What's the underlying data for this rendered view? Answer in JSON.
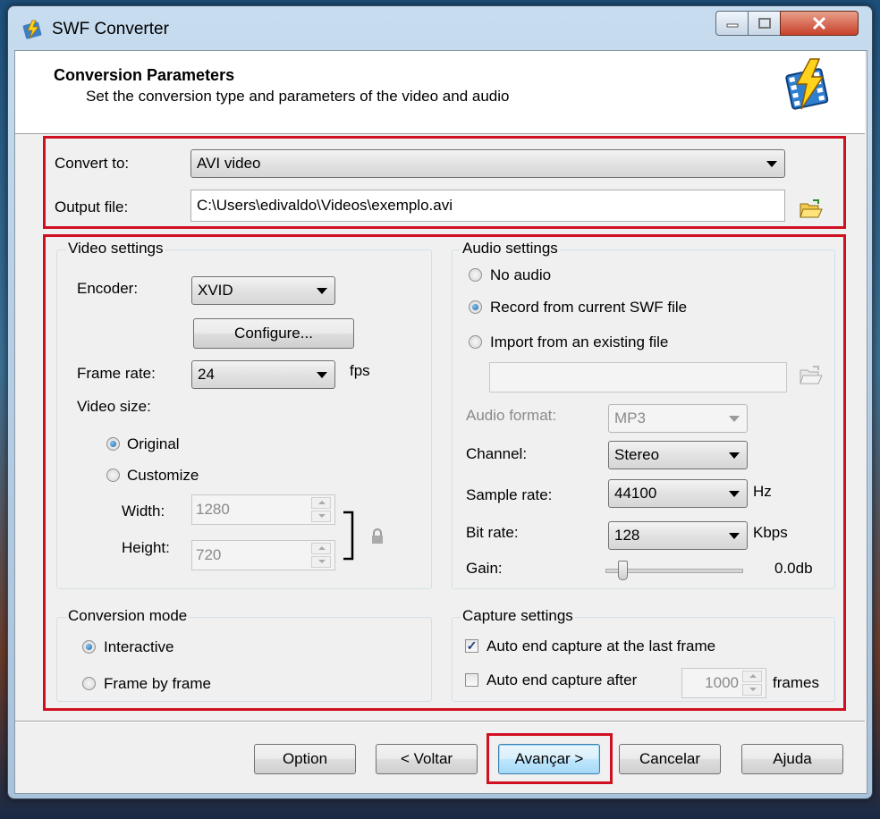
{
  "window": {
    "title": "SWF Converter"
  },
  "header": {
    "title": "Conversion Parameters",
    "subtitle": "Set the conversion type and parameters of the video and audio"
  },
  "convert": {
    "convert_to_label": "Convert to:",
    "convert_to_value": "AVI video",
    "output_file_label": "Output file:",
    "output_file_value": "C:\\Users\\edivaldo\\Videos\\exemplo.avi"
  },
  "video": {
    "group_title": "Video settings",
    "encoder_label": "Encoder:",
    "encoder_value": "XVID",
    "configure_label": "Configure...",
    "frame_rate_label": "Frame rate:",
    "frame_rate_value": "24",
    "fps_unit": "fps",
    "video_size_label": "Video size:",
    "original_label": "Original",
    "customize_label": "Customize",
    "width_label": "Width:",
    "width_value": "1280",
    "height_label": "Height:",
    "height_value": "720",
    "selected_size": "Original"
  },
  "audio": {
    "group_title": "Audio settings",
    "no_audio_label": "No audio",
    "record_label": "Record from current SWF file",
    "import_label": "Import from an existing file",
    "selected": "Record from current SWF file",
    "import_path_value": "",
    "format_label": "Audio format:",
    "format_value": "MP3",
    "channel_label": "Channel:",
    "channel_value": "Stereo",
    "sample_rate_label": "Sample rate:",
    "sample_rate_value": "44100",
    "sample_rate_unit": "Hz",
    "bit_rate_label": "Bit rate:",
    "bit_rate_value": "128",
    "bit_rate_unit": "Kbps",
    "gain_label": "Gain:",
    "gain_value": "0.0db",
    "gain_level": 0.1
  },
  "conversion_mode": {
    "group_title": "Conversion mode",
    "interactive_label": "Interactive",
    "frame_by_frame_label": "Frame by frame",
    "selected": "Interactive"
  },
  "capture": {
    "group_title": "Capture settings",
    "auto_end_last_label": "Auto end capture at the last frame",
    "auto_end_last_checked": true,
    "auto_end_after_label": "Auto end capture after",
    "auto_end_after_checked": false,
    "frames_value": "1000",
    "frames_unit": "frames"
  },
  "footer": {
    "option_label": "Option",
    "back_label": "< Voltar",
    "next_label": "Avançar >",
    "cancel_label": "Cancelar",
    "help_label": "Ajuda"
  },
  "colors": {
    "highlight_box": "#d01020",
    "accent": "#3c7fb1"
  }
}
